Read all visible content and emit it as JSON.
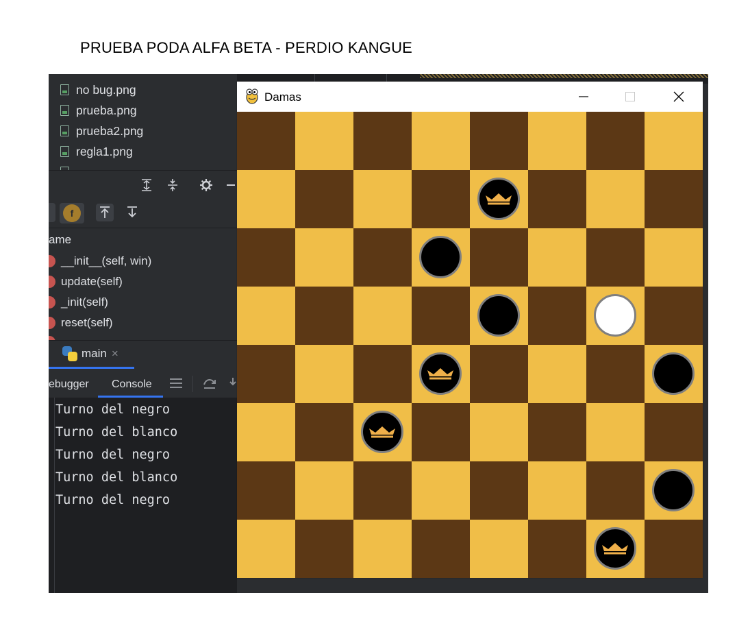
{
  "document": {
    "title": "PRUEBA PODA ALFA BETA - PERDIO KANGUE"
  },
  "ide": {
    "files": [
      "no bug.png",
      "prueba.png",
      "prueba2.png",
      "regla1.png"
    ],
    "structure": {
      "header": "ame",
      "items": [
        "__init__(self, win)",
        "update(self)",
        "_init(self)",
        "reset(self)"
      ]
    },
    "run_tab": {
      "label": "main",
      "close": "×"
    },
    "debug_tabs": {
      "debugger": "ebugger",
      "console": "Console"
    },
    "console_lines": [
      "Turno del negro",
      "Turno del blanco",
      "Turno del negro",
      "Turno del blanco",
      "Turno del negro"
    ]
  },
  "game_window": {
    "title": "Damas",
    "board": {
      "size": 8,
      "colors": {
        "light": "#F0BE48",
        "dark": "#5C3815",
        "crown": "#F0B04A",
        "piece_border": "#7F7F7F"
      },
      "pieces": [
        {
          "row": 1,
          "col": 4,
          "color": "black",
          "king": true
        },
        {
          "row": 2,
          "col": 3,
          "color": "black",
          "king": false
        },
        {
          "row": 3,
          "col": 4,
          "color": "black",
          "king": false
        },
        {
          "row": 3,
          "col": 6,
          "color": "white",
          "king": false
        },
        {
          "row": 4,
          "col": 3,
          "color": "black",
          "king": true
        },
        {
          "row": 4,
          "col": 7,
          "color": "black",
          "king": false
        },
        {
          "row": 5,
          "col": 2,
          "color": "black",
          "king": true
        },
        {
          "row": 6,
          "col": 7,
          "color": "black",
          "king": false
        },
        {
          "row": 7,
          "col": 6,
          "color": "black",
          "king": true
        }
      ]
    }
  }
}
